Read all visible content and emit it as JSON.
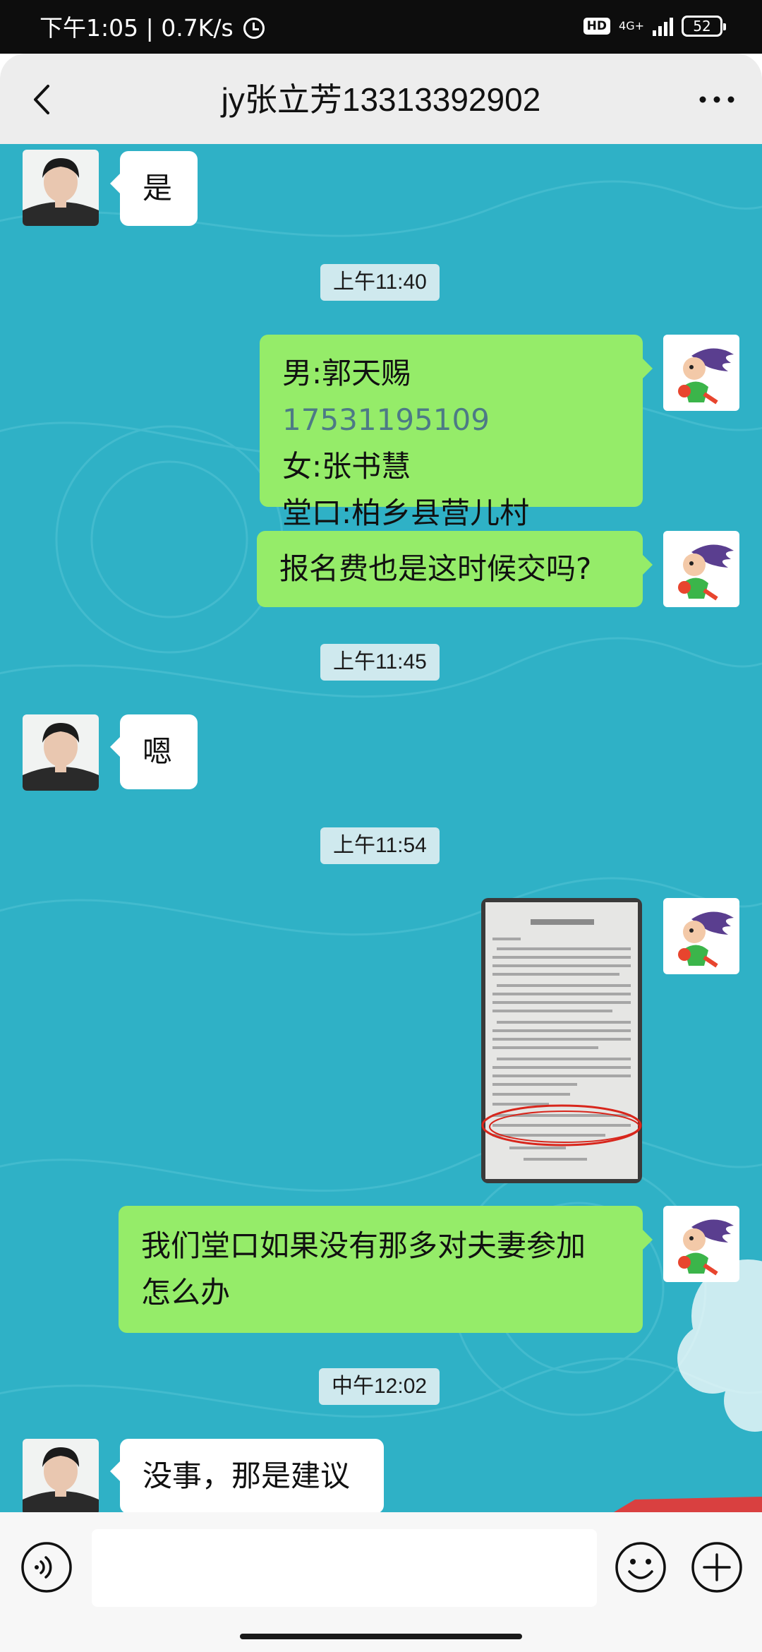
{
  "status_bar": {
    "time_speed": "下午1:05 | 0.7K/s",
    "hd": "HD",
    "network": "4G+",
    "battery": "52"
  },
  "header": {
    "title": "jy张立芳13313392902"
  },
  "chat": {
    "messages": [
      {
        "text": "是"
      },
      {
        "timestamp": "上午11:40"
      },
      {
        "line1_prefix": "男:郭天赐 ",
        "line1_phone": "17531195109",
        "line2": "女:张书慧",
        "line3": "堂口:柏乡县营儿村"
      },
      {
        "text": "报名费也是这时候交吗?"
      },
      {
        "timestamp": "上午11:45"
      },
      {
        "text": "嗯"
      },
      {
        "timestamp": "上午11:54"
      },
      {
        "image": "document-photo"
      },
      {
        "line1": "我们堂口如果没有那多对夫妻参加",
        "line2": "怎么办"
      },
      {
        "timestamp": "中午12:02"
      },
      {
        "text": "没事，那是建议"
      }
    ]
  },
  "input_bar": {
    "placeholder": ""
  },
  "colors": {
    "chat_bg": "#2fb1c6",
    "outgoing_bubble": "#95ec69",
    "incoming_bubble": "#ffffff",
    "timestamp_bg": "#cfe9ee"
  }
}
